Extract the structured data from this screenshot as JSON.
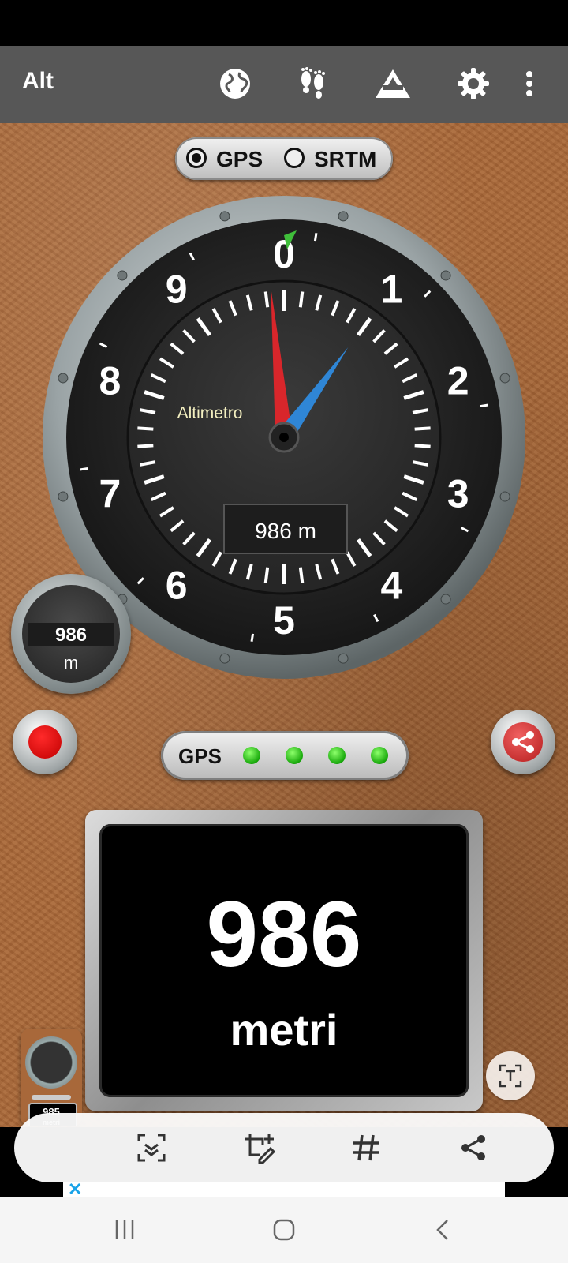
{
  "app_bar": {
    "title": "Alt",
    "icons": [
      "globe-icon",
      "footprints-icon",
      "altitude-triangle-icon",
      "gear-icon",
      "more-vertical-icon"
    ]
  },
  "source_toggle": {
    "options": [
      {
        "label": "GPS",
        "selected": true
      },
      {
        "label": "SRTM",
        "selected": false
      }
    ]
  },
  "gauge": {
    "label": "Altimetro",
    "readout": "986 m",
    "dial_numbers": [
      "0",
      "1",
      "2",
      "3",
      "4",
      "5",
      "6",
      "7",
      "8",
      "9"
    ],
    "altitude_m": 986,
    "colors": {
      "long_needle": "#d8262b",
      "short_needle": "#2f86d6",
      "marker": "#3fbf3a",
      "face": "#2b2b2b",
      "bezel": "#9aa3a5"
    }
  },
  "mini_gauge": {
    "value": "986",
    "unit": "m"
  },
  "gps_status": {
    "label": "GPS",
    "leds": 4,
    "led_color": "#22c014"
  },
  "display": {
    "value": "986",
    "unit": "metri"
  },
  "thumbnail": {
    "value": "985",
    "unit": "metri"
  },
  "toolbar": {
    "icons": [
      "scan-document-icon",
      "edit-crop-icon",
      "hashtag-icon",
      "share-icon"
    ]
  },
  "ad": {
    "close": "✕"
  },
  "nav": {
    "icons": [
      "recent-apps-icon",
      "home-icon",
      "back-icon"
    ]
  },
  "colors": {
    "leather": "#a8683a",
    "app_bar": "#575757"
  }
}
